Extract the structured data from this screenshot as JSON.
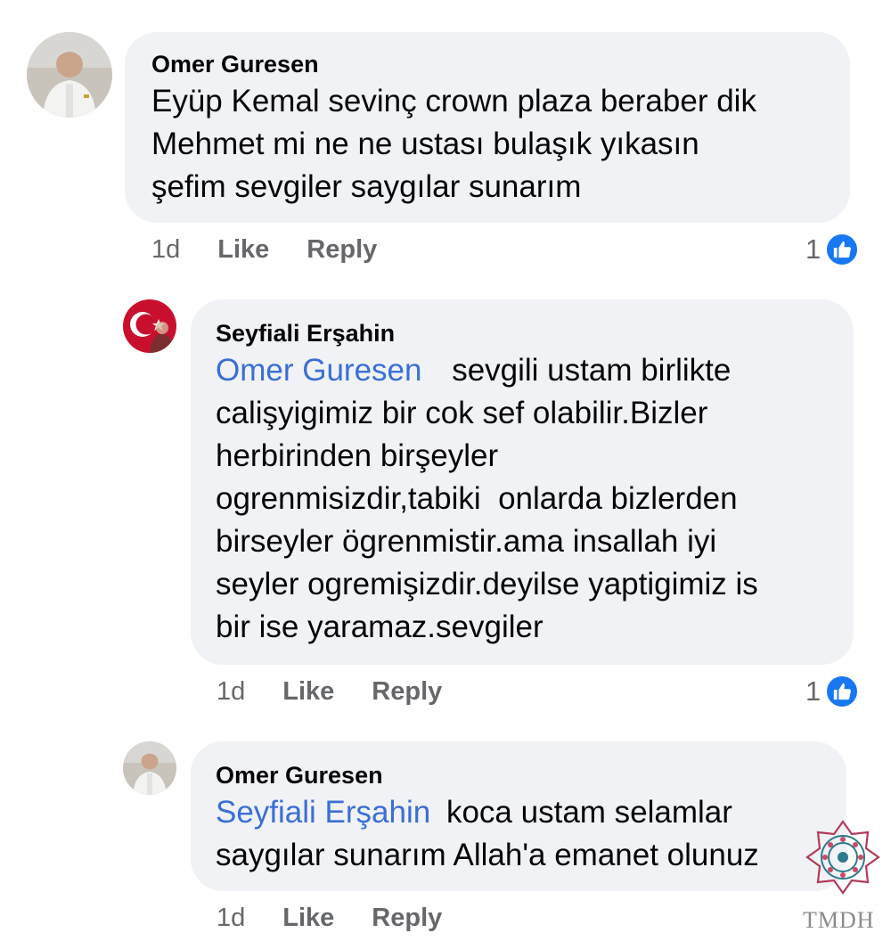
{
  "comments": [
    {
      "author": "Omer Guresen",
      "lines": [
        "Eyüp Kemal sevinç crown plaza beraber dik",
        "Mehmet mi ne ne ustası bulaşık yıkasın",
        "şefim sevgiler saygılar sunarım"
      ],
      "time": "1d",
      "like_label": "Like",
      "reply_label": "Reply",
      "reaction_count": "1"
    },
    {
      "author": "Seyfiali Erşahin",
      "mention": "Omer Guresen",
      "first_line_rest": "sevgili ustam birlikte",
      "lines": [
        "calişyigimiz bir cok sef olabilir.Bizler",
        "herbirinden birşeyler",
        "ogrenmisizdir,tabiki  onlarda bizlerden",
        "birseyler ögrenmistir.ama insallah iyi",
        "seyler ogremişizdir.deyilse yaptigimiz is",
        "bir ise yaramaz.sevgiler"
      ],
      "time": "1d",
      "like_label": "Like",
      "reply_label": "Reply",
      "reaction_count": "1"
    },
    {
      "author": "Omer Guresen",
      "mention": "Seyfiali Erşahin",
      "first_line_rest": "koca ustam selamlar",
      "lines": [
        "saygılar sunarım Allah'a emanet olunuz"
      ],
      "time": "1d",
      "like_label": "Like",
      "reply_label": "Reply"
    }
  ],
  "watermark": {
    "text": "TMDH"
  },
  "colors": {
    "bubble": "#f0f2f5",
    "mention": "#3b6fd4",
    "meta": "#65676b",
    "like_badge": "#1877f2"
  },
  "icons": {
    "reaction": "like-thumbs-up-icon"
  }
}
